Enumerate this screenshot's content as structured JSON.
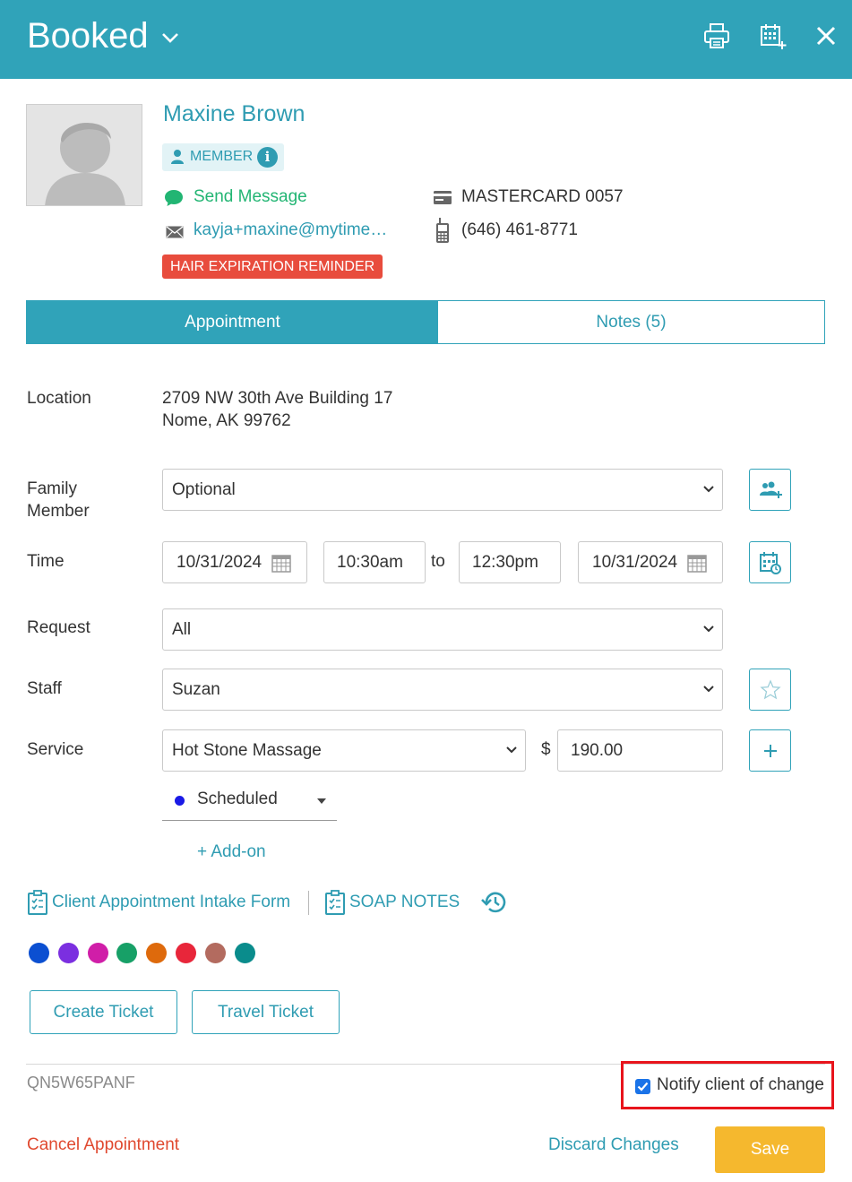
{
  "header": {
    "title": "Booked",
    "icons": [
      "chevron-down-icon",
      "printer-icon",
      "calendar-add-icon",
      "close-icon"
    ],
    "color": "#30a3b9"
  },
  "client": {
    "name": "Maxine Brown",
    "membership_label": "MEMBER",
    "send_message_label": "Send Message",
    "email": "kayja+maxine@mytime…",
    "card": "MASTERCARD 0057",
    "phone": "(646) 461-8771",
    "reminder_tag": "HAIR EXPIRATION REMINDER"
  },
  "tabs": [
    {
      "label": "Appointment",
      "active": true
    },
    {
      "label": "Notes (5)",
      "active": false
    }
  ],
  "form": {
    "location_label": "Location",
    "location_line1": "2709 NW 30th Ave Building 17",
    "location_line2": "Nome, AK 99762",
    "family_label_1": "Family",
    "family_label_2": "Member",
    "family_value": "Optional",
    "time_label": "Time",
    "start_date": "10/31/2024",
    "start_time": "10:30am",
    "to_label": "to",
    "end_time": "12:30pm",
    "end_date": "10/31/2024",
    "request_label": "Request",
    "request_value": "All",
    "staff_label": "Staff",
    "staff_value": "Suzan",
    "service_label": "Service",
    "service_value": "Hot Stone Massage",
    "currency_symbol": "$",
    "price": "190.00",
    "status": "Scheduled",
    "addon_label": "+ Add-on"
  },
  "links": {
    "intake_form": "Client Appointment Intake Form",
    "soap_notes": "SOAP NOTES"
  },
  "colors": [
    "#0b4fd1",
    "#7b2fe0",
    "#d01ea8",
    "#17a067",
    "#de6a0c",
    "#e8263a",
    "#b36b5f",
    "#0a8c8c"
  ],
  "buttons": {
    "create_ticket": "Create Ticket",
    "travel_ticket": "Travel Ticket",
    "cancel": "Cancel Appointment",
    "discard": "Discard Changes",
    "save": "Save"
  },
  "footer": {
    "code": "QN5W65PANF",
    "notify_label": "Notify client of change",
    "notify_checked": true
  }
}
